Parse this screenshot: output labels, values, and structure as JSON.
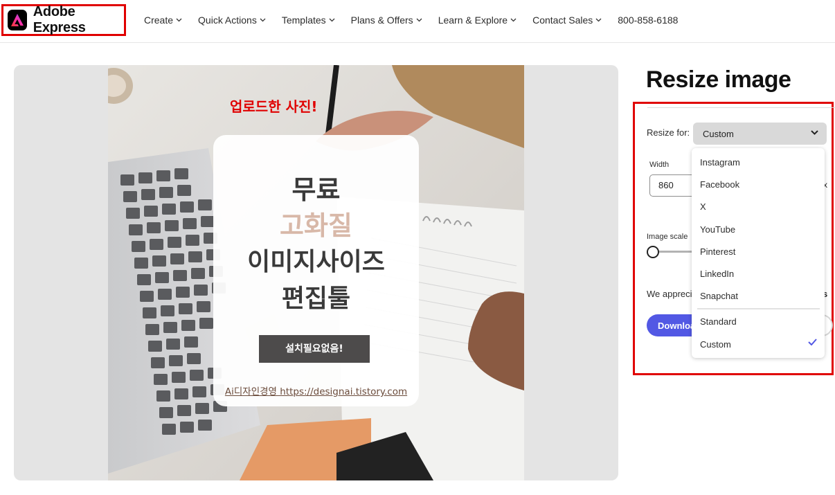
{
  "header": {
    "brand": "Adobe Express",
    "nav": [
      {
        "label": "Create"
      },
      {
        "label": "Quick Actions"
      },
      {
        "label": "Templates"
      },
      {
        "label": "Plans & Offers"
      },
      {
        "label": "Learn & Explore"
      },
      {
        "label": "Contact Sales"
      }
    ],
    "phone": "800-858-6188"
  },
  "preview": {
    "annotation": "업로드한 사진!",
    "card": {
      "line1": "무료",
      "line2": "고화질",
      "line3": "이미지사이즈",
      "line4": "편집툴",
      "button": "설치필요없음!",
      "footer": "Ai디자인경영 https://designai.tistory.com"
    }
  },
  "panel": {
    "title": "Resize image",
    "resize_for_label": "Resize for:",
    "resize_for_value": "Custom",
    "width_label": "Width",
    "width_value": "860",
    "unit_fragment": "x",
    "scale_label": "Image scale",
    "appreciate_text": "We apprecia",
    "appreciate_end": "s",
    "download_label": "Downloa"
  },
  "dropdown": {
    "options": [
      "Instagram",
      "Facebook",
      "X",
      "YouTube",
      "Pinterest",
      "LinkedIn",
      "Snapchat"
    ],
    "presets": [
      "Standard",
      "Custom"
    ],
    "selected": "Custom"
  },
  "colors": {
    "highlight": "#e00000",
    "accent": "#5258e4",
    "annotation": "#e00000"
  }
}
